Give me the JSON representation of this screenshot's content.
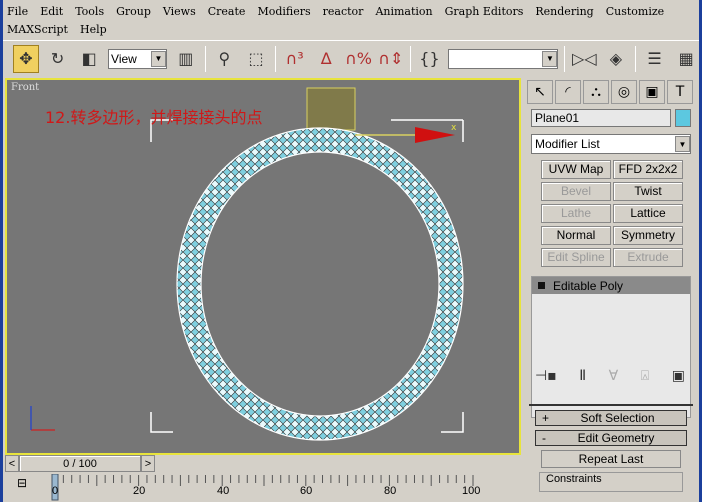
{
  "menu": {
    "row1": [
      "File",
      "Edit",
      "Tools",
      "Group",
      "Views",
      "Create",
      "Modifiers",
      "reactor",
      "Animation",
      "Graph Editors",
      "Rendering",
      "Customize"
    ],
    "row2": [
      "MAXScript",
      "Help"
    ]
  },
  "toolbar": {
    "view_select": "View",
    "named_selection": ""
  },
  "viewport": {
    "label": "Front",
    "annotation": "12.转多边形，并焊接接头的点",
    "object_color": "#5cc8e0",
    "border_color": "#e8e43c"
  },
  "panel": {
    "object_name": "Plane01",
    "modifier_list": "Modifier List",
    "modifiers": [
      {
        "label": "UVW Map",
        "enabled": true
      },
      {
        "label": "FFD 2x2x2",
        "enabled": true
      },
      {
        "label": "Bevel",
        "enabled": false
      },
      {
        "label": "Twist",
        "enabled": true
      },
      {
        "label": "Lathe",
        "enabled": false
      },
      {
        "label": "Lattice",
        "enabled": true
      },
      {
        "label": "Normal",
        "enabled": true
      },
      {
        "label": "Symmetry",
        "enabled": true
      },
      {
        "label": "Edit Spline",
        "enabled": false
      },
      {
        "label": "Extrude",
        "enabled": false
      }
    ],
    "stack": [
      "Editable Poly"
    ],
    "rollouts": [
      {
        "sign": "+",
        "label": "Soft Selection"
      },
      {
        "sign": "-",
        "label": "Edit Geometry"
      }
    ],
    "repeat_last": "Repeat Last",
    "constraints": "Constraints"
  },
  "timeslider": {
    "value": "0 / 100",
    "prev": "<",
    "next": ">"
  },
  "timeline": {
    "ticks": [
      "0",
      "20",
      "40",
      "60",
      "80",
      "100"
    ]
  }
}
